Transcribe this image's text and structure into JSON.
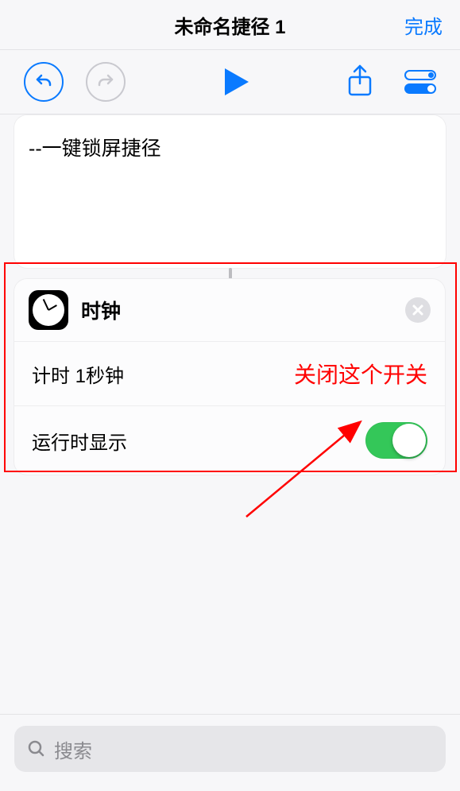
{
  "header": {
    "title": "未命名捷径 1",
    "done": "完成"
  },
  "card1": {
    "text": "--一键锁屏捷径"
  },
  "card2": {
    "title": "时钟",
    "timer_row": "计时 1秒钟",
    "switch_row": "运行时显示"
  },
  "annotation": {
    "label": "关闭这个开关"
  },
  "search": {
    "placeholder": "搜索"
  }
}
